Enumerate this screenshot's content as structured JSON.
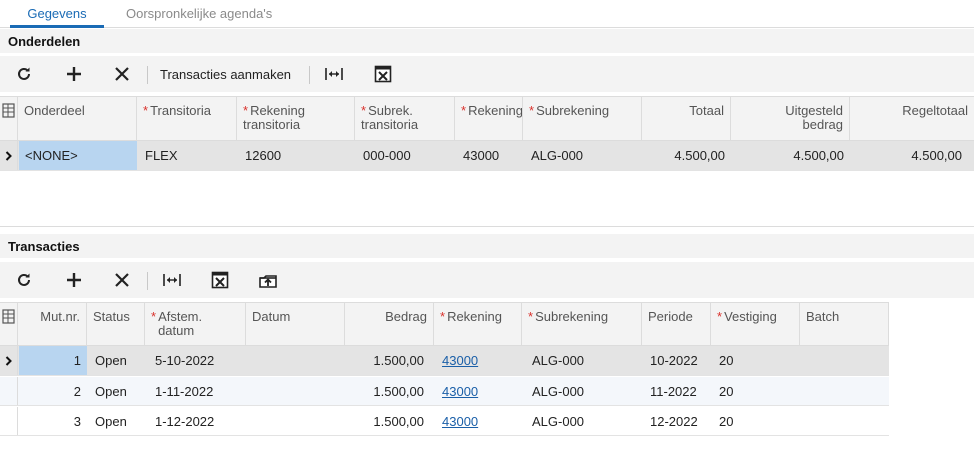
{
  "tabs": [
    {
      "label": "Gegevens",
      "active": true
    },
    {
      "label": "Oorspronkelijke agenda's",
      "active": false
    }
  ],
  "onderdelen": {
    "title": "Onderdelen",
    "toolbar": {
      "create_transactions_label": "Transacties aanmaken"
    },
    "columns": [
      {
        "label": "Onderdeel",
        "required": false,
        "align": "left"
      },
      {
        "label": "Transitoria",
        "required": true,
        "align": "left"
      },
      {
        "label": "Rekening transitoria",
        "required": true,
        "align": "left"
      },
      {
        "label": "Subrek. transitoria",
        "required": true,
        "align": "left"
      },
      {
        "label": "Rekening",
        "required": true,
        "align": "left"
      },
      {
        "label": "Subrekening",
        "required": true,
        "align": "left"
      },
      {
        "label": "Totaal",
        "required": false,
        "align": "right"
      },
      {
        "label": "Uitgesteld bedrag",
        "required": false,
        "align": "right"
      },
      {
        "label": "Regeltotaal",
        "required": false,
        "align": "right"
      }
    ],
    "rows": [
      {
        "onderdeel": "<NONE>",
        "transitoria": "FLEX",
        "rekening_transitoria": "12600",
        "subrek_transitoria": "000-000",
        "rekening": "43000",
        "subrekening": "ALG-000",
        "totaal": "4.500,00",
        "uitgesteld": "4.500,00",
        "regeltotaal": "4.500,00"
      }
    ]
  },
  "transacties": {
    "title": "Transacties",
    "columns": [
      {
        "label": "Mut.nr.",
        "required": false,
        "align": "right"
      },
      {
        "label": "Status",
        "required": false,
        "align": "left"
      },
      {
        "label": "Afstem. datum",
        "required": true,
        "align": "left"
      },
      {
        "label": "Datum",
        "required": false,
        "align": "left"
      },
      {
        "label": "Bedrag",
        "required": false,
        "align": "right"
      },
      {
        "label": "Rekening",
        "required": true,
        "align": "left"
      },
      {
        "label": "Subrekening",
        "required": true,
        "align": "left"
      },
      {
        "label": "Periode",
        "required": false,
        "align": "left"
      },
      {
        "label": "Vestiging",
        "required": true,
        "align": "left"
      },
      {
        "label": "Batch",
        "required": false,
        "align": "left"
      }
    ],
    "rows": [
      {
        "mutnr": "1",
        "status": "Open",
        "afstem_datum": "5-10-2022",
        "datum": "",
        "bedrag": "1.500,00",
        "rekening": "43000",
        "subrekening": "ALG-000",
        "periode": "10-2022",
        "vestiging": "20",
        "batch": ""
      },
      {
        "mutnr": "2",
        "status": "Open",
        "afstem_datum": "1-11-2022",
        "datum": "",
        "bedrag": "1.500,00",
        "rekening": "43000",
        "subrekening": "ALG-000",
        "periode": "11-2022",
        "vestiging": "20",
        "batch": ""
      },
      {
        "mutnr": "3",
        "status": "Open",
        "afstem_datum": "1-12-2022",
        "datum": "",
        "bedrag": "1.500,00",
        "rekening": "43000",
        "subrekening": "ALG-000",
        "periode": "12-2022",
        "vestiging": "20",
        "batch": ""
      }
    ]
  },
  "icons": {
    "refresh": "refresh-icon",
    "add": "plus-icon",
    "delete": "x-icon",
    "fit_columns": "fit-columns-icon",
    "export_excel": "excel-export-icon",
    "upload": "upload-icon",
    "column_config": "column-config-icon",
    "row_pointer": "row-pointer-icon"
  },
  "colors": {
    "accent": "#1a6bb5",
    "required": "#d9312b",
    "active_cell": "#b8d5f0",
    "link": "#1a5fa8"
  }
}
